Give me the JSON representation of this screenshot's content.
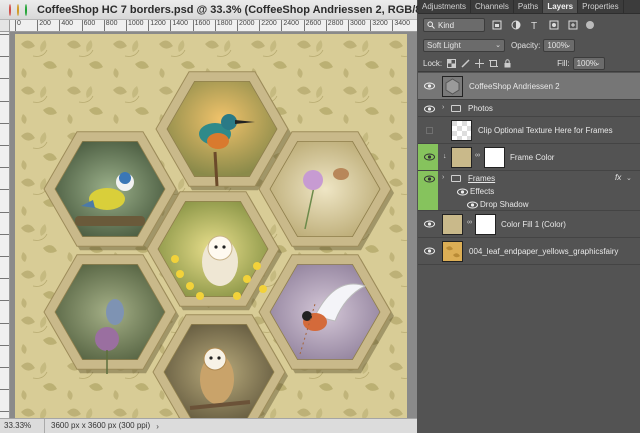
{
  "window": {
    "title": "CoffeeShop HC 7 borders.psd @ 33.3% (CoffeeShop Andriessen 2, RGB/8) *",
    "traffic_colors": [
      "#fe5f57",
      "#febc2e",
      "#28c840"
    ]
  },
  "ruler": {
    "h_labels": [
      "0",
      "200",
      "400",
      "600",
      "800",
      "1000",
      "1200",
      "1400",
      "1600",
      "1800",
      "2000",
      "2200",
      "2400",
      "2600",
      "2800",
      "3000",
      "3200",
      "3400"
    ]
  },
  "status": {
    "zoom": "33.33%",
    "doc_info": "3600 px x 3600 px (300 ppi)",
    "arrow": "›"
  },
  "panel": {
    "tabs": [
      "Adjustments",
      "Channels",
      "Paths",
      "Layers",
      "Properties"
    ],
    "active_tab": "Layers",
    "filter_kind": "Kind",
    "blend_mode": "Soft Light",
    "opacity_label": "Opacity:",
    "opacity": "100%",
    "lock_label": "Lock:",
    "fill_label": "Fill:",
    "fill": "100%",
    "fx": "fx"
  },
  "layers": [
    {
      "name": "CoffeeShop Andriessen 2",
      "visible": true,
      "selected": true
    },
    {
      "name": "Photos",
      "visible": true,
      "group": true
    },
    {
      "name": "Clip Optional Texture Here for Frames",
      "visible": false
    },
    {
      "name": "Frame Color",
      "visible": true
    },
    {
      "name": "Frames",
      "visible": true,
      "group": true
    },
    {
      "name": "Effects",
      "visible": true
    },
    {
      "name": "Drop Shadow",
      "visible": true
    },
    {
      "name": "Color Fill 1 (Color)",
      "visible": true
    },
    {
      "name": "004_leaf_endpaper_yellows_graphicsfairy",
      "visible": true
    }
  ],
  "colors": {
    "accent_green": "#86c35d",
    "frame_color": "#c9b98a",
    "paper": "#d8cc96",
    "leaf": "#a99c5c"
  }
}
